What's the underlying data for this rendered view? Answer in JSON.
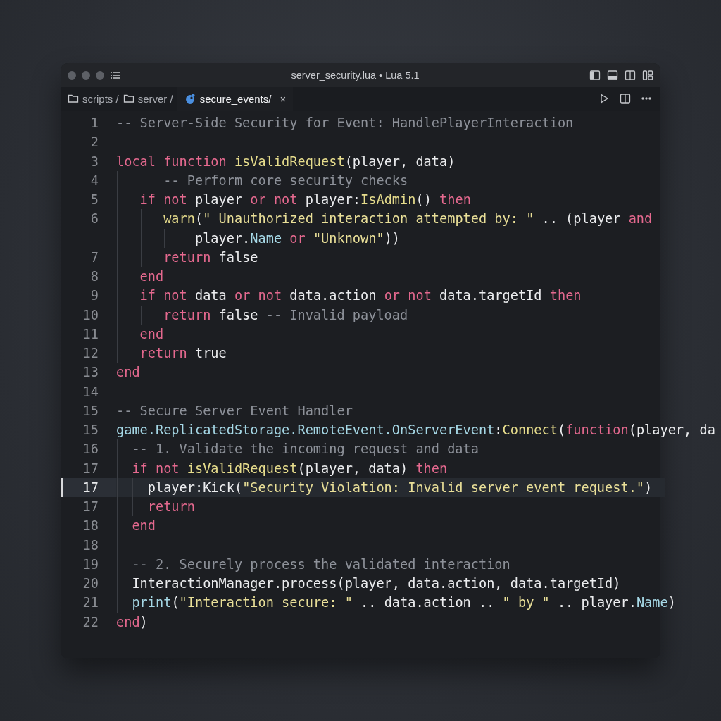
{
  "window": {
    "title": "server_security.lua • Lua 5.1"
  },
  "breadcrumbs": [
    {
      "label": "scripts /"
    },
    {
      "label": "server /"
    }
  ],
  "tab": {
    "label": "secure_events/",
    "selected": true,
    "close": "×"
  },
  "lines": [
    {
      "number": "1",
      "current": false,
      "tokens": [
        {
          "kind": "cmt",
          "text": "-- Server-Side Security for Event: HandlePlayerInteraction"
        }
      ]
    },
    {
      "number": "2",
      "current": false
    },
    {
      "number": "3",
      "current": false,
      "tokens": [
        {
          "kind": "kw",
          "text": "local function "
        },
        {
          "kind": "fn",
          "text": "isValidRequest"
        },
        {
          "kind": "plain",
          "text": "(player, data)"
        }
      ]
    },
    {
      "number": "4",
      "current": false,
      "tokens": [
        {
          "kind": "cmt",
          "text": "      -- Perform core security checks"
        }
      ]
    },
    {
      "number": "5",
      "current": false,
      "tokens": [
        {
          "kind": "kw",
          "text": "   if not "
        },
        {
          "kind": "plain",
          "text": "player "
        },
        {
          "kind": "kw",
          "text": "or not "
        },
        {
          "kind": "plain",
          "text": "player:"
        },
        {
          "kind": "fn",
          "text": "IsAdmin"
        },
        {
          "kind": "plain",
          "text": "() "
        },
        {
          "kind": "kw",
          "text": "then"
        }
      ]
    },
    {
      "number": "6",
      "current": false,
      "tokens": [
        {
          "kind": "fn",
          "text": "      warn"
        },
        {
          "kind": "plain",
          "text": "("
        },
        {
          "kind": "str",
          "text": "\" Unauthorized interaction attempted by: \""
        },
        {
          "kind": "plain",
          "text": " .. (player "
        },
        {
          "kind": "kw",
          "text": "and"
        }
      ]
    },
    {
      "current": false,
      "tokens": [
        {
          "kind": "plain",
          "text": "          player."
        },
        {
          "kind": "prop",
          "text": "Name"
        },
        {
          "kind": "kw",
          "text": " or "
        },
        {
          "kind": "str",
          "text": "\"Unknown\""
        },
        {
          "kind": "plain",
          "text": "))"
        }
      ]
    },
    {
      "number": "7",
      "current": false,
      "tokens": [
        {
          "kind": "kw",
          "text": "      return "
        },
        {
          "kind": "plain",
          "text": "false"
        }
      ]
    },
    {
      "number": "8",
      "current": false,
      "tokens": [
        {
          "kind": "kw",
          "text": "   end"
        }
      ]
    },
    {
      "number": "9",
      "current": false,
      "tokens": [
        {
          "kind": "kw",
          "text": "   if not "
        },
        {
          "kind": "plain",
          "text": "data "
        },
        {
          "kind": "kw",
          "text": "or not "
        },
        {
          "kind": "plain",
          "text": "data.action "
        },
        {
          "kind": "kw",
          "text": "or not "
        },
        {
          "kind": "plain",
          "text": "data.targetId "
        },
        {
          "kind": "kw",
          "text": "then"
        }
      ]
    },
    {
      "number": "10",
      "current": false,
      "tokens": [
        {
          "kind": "kw",
          "text": "      return "
        },
        {
          "kind": "plain",
          "text": "false "
        },
        {
          "kind": "cmt",
          "text": "-- Invalid payload"
        }
      ]
    },
    {
      "number": "11",
      "current": false,
      "tokens": [
        {
          "kind": "kw",
          "text": "   end"
        }
      ]
    },
    {
      "number": "12",
      "current": false,
      "tokens": [
        {
          "kind": "kw",
          "text": "   return "
        },
        {
          "kind": "plain",
          "text": "true"
        }
      ]
    },
    {
      "number": "13",
      "current": false,
      "tokens": [
        {
          "kind": "kw",
          "text": "end"
        }
      ]
    },
    {
      "number": "14",
      "current": false
    },
    {
      "number": "15",
      "current": false,
      "tokens": [
        {
          "kind": "cmt",
          "text": "-- Secure Server Event Handler"
        }
      ]
    },
    {
      "number": "15",
      "current": false,
      "tokens": [
        {
          "kind": "prop",
          "text": "game.ReplicatedStorage.RemoteEvent.OnServerEvent"
        },
        {
          "kind": "plain",
          "text": ":"
        },
        {
          "kind": "fn",
          "text": "Connect"
        },
        {
          "kind": "plain",
          "text": "("
        },
        {
          "kind": "kw",
          "text": "function"
        },
        {
          "kind": "plain",
          "text": "(player, da"
        }
      ]
    },
    {
      "number": "16",
      "current": false,
      "tokens": [
        {
          "kind": "cmt",
          "text": "  -- 1. Validate the incoming request and data"
        }
      ]
    },
    {
      "number": "17",
      "current": false,
      "tokens": [
        {
          "kind": "kw",
          "text": "  if not "
        },
        {
          "kind": "fn",
          "text": "isValidRequest"
        },
        {
          "kind": "plain",
          "text": "(player, data) "
        },
        {
          "kind": "kw",
          "text": "then"
        }
      ]
    },
    {
      "number": "17",
      "current": true,
      "tokens": [
        {
          "kind": "plain",
          "text": "    player:Kick("
        },
        {
          "kind": "str",
          "text": "\"Security Violation: Invalid server event request.\""
        },
        {
          "kind": "plain",
          "text": ")"
        }
      ]
    },
    {
      "number": "17",
      "current": false,
      "tokens": [
        {
          "kind": "kw",
          "text": "    return"
        }
      ]
    },
    {
      "number": "18",
      "current": false,
      "tokens": [
        {
          "kind": "kw",
          "text": "  end"
        }
      ]
    },
    {
      "number": "18",
      "current": false
    },
    {
      "number": "19",
      "current": false,
      "tokens": [
        {
          "kind": "cmt",
          "text": "  -- 2. Securely process the validated interaction"
        }
      ]
    },
    {
      "number": "20",
      "current": false,
      "tokens": [
        {
          "kind": "plain",
          "text": "  InteractionManager.process(player, data.action, data.targetId)"
        }
      ]
    },
    {
      "number": "21",
      "current": false,
      "tokens": [
        {
          "kind": "prop",
          "text": "  print"
        },
        {
          "kind": "plain",
          "text": "("
        },
        {
          "kind": "str",
          "text": "\"Interaction secure: \""
        },
        {
          "kind": "plain",
          "text": " .. data.action .. "
        },
        {
          "kind": "str",
          "text": "\" by \""
        },
        {
          "kind": "plain",
          "text": " .. player."
        },
        {
          "kind": "prop",
          "text": "Name"
        },
        {
          "kind": "plain",
          "text": ")"
        }
      ]
    },
    {
      "number": "22",
      "current": false,
      "tokens": [
        {
          "kind": "kw",
          "text": "end"
        },
        {
          "kind": "plain",
          "text": ")"
        }
      ]
    }
  ]
}
